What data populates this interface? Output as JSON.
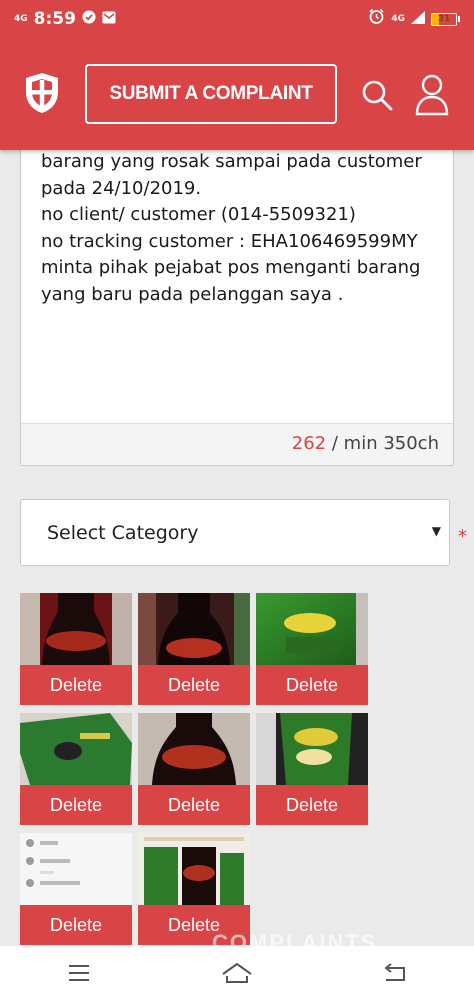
{
  "status_bar": {
    "network_left": "4G",
    "time": "8:59",
    "network_right": "4G",
    "battery_level": "31"
  },
  "header": {
    "submit_button_label": "SUBMIT A COMPLAINT"
  },
  "complaint": {
    "text": "barang yang rosak sampai pada customer\npada 24/10/2019.\nno client/ customer (014-5509321)\nno tracking customer : EHA106469599MY\nminta pihak pejabat pos menganti barang\nyang baru pada pelanggan saya .",
    "char_count": "262",
    "char_min": "/ min 350ch"
  },
  "category": {
    "selected": "Select Category",
    "required_mark": "*"
  },
  "attachments": {
    "delete_label": "Delete",
    "items": [
      "photo-1",
      "photo-2",
      "photo-3",
      "photo-4",
      "photo-5",
      "photo-6",
      "photo-7",
      "photo-8"
    ]
  },
  "watermark": "COMPLAINTS",
  "colors": {
    "brand": "#d94447",
    "accent_text": "#d94447"
  }
}
